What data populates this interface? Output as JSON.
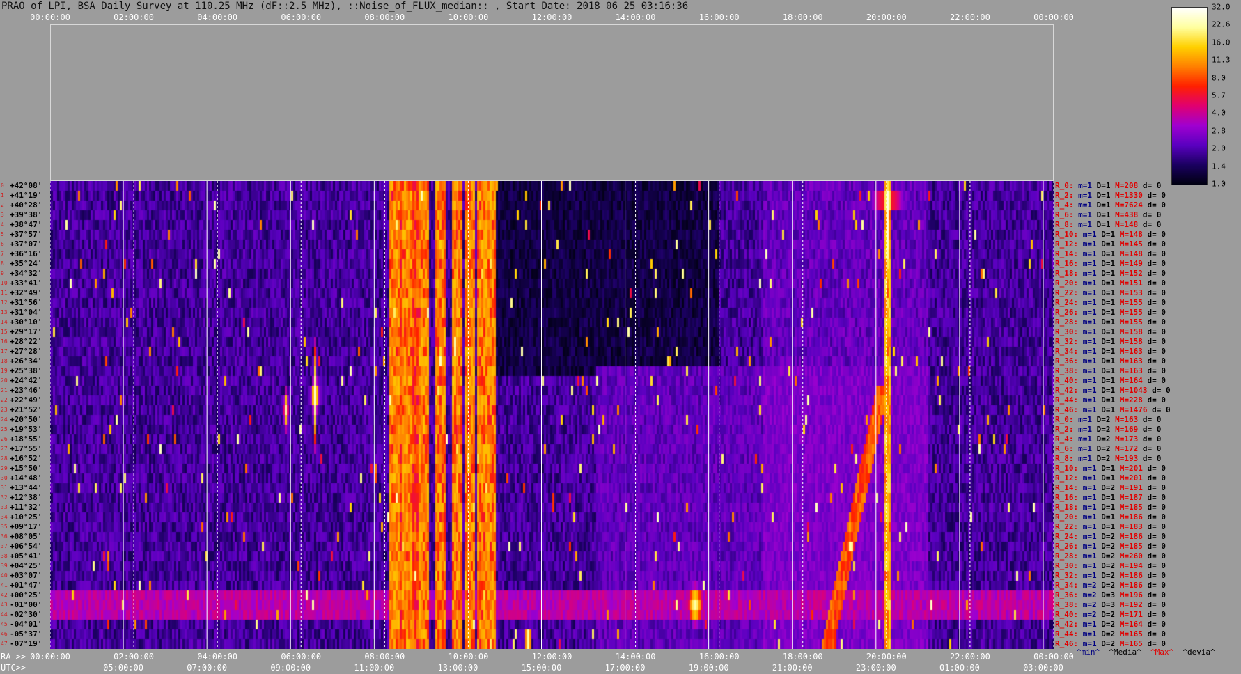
{
  "title": "PRAO of LPI, BSA Daily Survey at 110.25 MHz (dF::2.5 MHz), ::Noise_of_FLUX_median:: , Start Date: 2018 06 25 03:16:36",
  "top_axis_labels": [
    "00:00:00",
    "02:00:00",
    "04:00:00",
    "06:00:00",
    "08:00:00",
    "10:00:00",
    "12:00:00",
    "14:00:00",
    "16:00:00",
    "18:00:00",
    "20:00:00",
    "22:00:00",
    "00:00:00"
  ],
  "ra_prefix": "RA >>",
  "ra_labels": [
    "00:00:00",
    "02:00:00",
    "04:00:00",
    "06:00:00",
    "08:00:00",
    "10:00:00",
    "12:00:00",
    "14:00:00",
    "16:00:00",
    "18:00:00",
    "20:00:00",
    "22:00:00",
    "00:00:00"
  ],
  "utc_prefix": "UTC>>",
  "utc_labels": [
    "05:00:00",
    "07:00:00",
    "09:00:00",
    "11:00:00",
    "13:00:00",
    "15:00:00",
    "17:00:00",
    "19:00:00",
    "21:00:00",
    "23:00:00",
    "01:00:00",
    "03:00:00"
  ],
  "declinations": [
    "+42°08'",
    "+41°19'",
    "+40°28'",
    "+39°38'",
    "+38°47'",
    "+37°57'",
    "+37°07'",
    "+36°16'",
    "+35°24'",
    "+34°32'",
    "+33°41'",
    "+32°49'",
    "+31°56'",
    "+31°04'",
    "+30°10'",
    "+29°17'",
    "+28°22'",
    "+27°28'",
    "+26°34'",
    "+25°38'",
    "+24°42'",
    "+23°46'",
    "+22°49'",
    "+21°52'",
    "+20°50'",
    "+19°53'",
    "+18°55'",
    "+17°55'",
    "+16°52'",
    "+15°50'",
    "+14°48'",
    "+13°44'",
    "+12°38'",
    "+11°32'",
    "+10°25'",
    "+09°17'",
    "+08°05'",
    "+06°54'",
    "+05°41'",
    "+04°25'",
    "+03°07'",
    "+01°47'",
    "+00°25'",
    "-01°00'",
    "-02°30'",
    "-04°01'",
    "-05°37'",
    "-07°19'"
  ],
  "row_numbers": [
    "0",
    "1",
    "2",
    "3",
    "4",
    "5",
    "6",
    "7",
    "8",
    "9",
    "10",
    "11",
    "12",
    "13",
    "14",
    "15",
    "16",
    "17",
    "18",
    "19",
    "20",
    "21",
    "22",
    "23",
    "24",
    "25",
    "26",
    "27",
    "28",
    "29",
    "30",
    "31",
    "32",
    "33",
    "34",
    "35",
    "36",
    "37",
    "38",
    "39",
    "40",
    "41",
    "42",
    "43",
    "44",
    "45",
    "46",
    "47"
  ],
  "right_labels": [
    {
      "r": "R_0:",
      "m": "m=1",
      "D": "D=1",
      "M": "M=208",
      "d": "d= 0"
    },
    {
      "r": "R_2:",
      "m": "m=1",
      "D": "D=1",
      "M": "M=1330",
      "d": "d= 0"
    },
    {
      "r": "R_4:",
      "m": "m=1",
      "D": "D=1",
      "M": "M=7624",
      "d": "d= 0"
    },
    {
      "r": "R_6:",
      "m": "m=1",
      "D": "D=1",
      "M": "M=438",
      "d": "d= 0"
    },
    {
      "r": "R_8:",
      "m": "m=1",
      "D": "D=1",
      "M": "M=148",
      "d": "d= 0"
    },
    {
      "r": "R_10:",
      "m": "m=1",
      "D": "D=1",
      "M": "M=148",
      "d": "d= 0"
    },
    {
      "r": "R_12:",
      "m": "m=1",
      "D": "D=1",
      "M": "M=145",
      "d": "d= 0"
    },
    {
      "r": "R_14:",
      "m": "m=1",
      "D": "D=1",
      "M": "M=148",
      "d": "d= 0"
    },
    {
      "r": "R_16:",
      "m": "m=1",
      "D": "D=1",
      "M": "M=149",
      "d": "d= 0"
    },
    {
      "r": "R_18:",
      "m": "m=1",
      "D": "D=1",
      "M": "M=152",
      "d": "d= 0"
    },
    {
      "r": "R_20:",
      "m": "m=1",
      "D": "D=1",
      "M": "M=151",
      "d": "d= 0"
    },
    {
      "r": "R_22:",
      "m": "m=1",
      "D": "D=1",
      "M": "M=153",
      "d": "d= 0"
    },
    {
      "r": "R_24:",
      "m": "m=1",
      "D": "D=1",
      "M": "M=155",
      "d": "d= 0"
    },
    {
      "r": "R_26:",
      "m": "m=1",
      "D": "D=1",
      "M": "M=155",
      "d": "d= 0"
    },
    {
      "r": "R_28:",
      "m": "m=1",
      "D": "D=1",
      "M": "M=155",
      "d": "d= 0"
    },
    {
      "r": "R_30:",
      "m": "m=1",
      "D": "D=1",
      "M": "M=158",
      "d": "d= 0"
    },
    {
      "r": "R_32:",
      "m": "m=1",
      "D": "D=1",
      "M": "M=158",
      "d": "d= 0"
    },
    {
      "r": "R_34:",
      "m": "m=1",
      "D": "D=1",
      "M": "M=163",
      "d": "d= 0"
    },
    {
      "r": "R_36:",
      "m": "m=1",
      "D": "D=1",
      "M": "M=163",
      "d": "d= 0"
    },
    {
      "r": "R_38:",
      "m": "m=1",
      "D": "D=1",
      "M": "M=163",
      "d": "d= 0"
    },
    {
      "r": "R_40:",
      "m": "m=1",
      "D": "D=1",
      "M": "M=164",
      "d": "d= 0"
    },
    {
      "r": "R_42:",
      "m": "m=1",
      "D": "D=1",
      "M": "M=1043",
      "d": "d= 0"
    },
    {
      "r": "R_44:",
      "m": "m=1",
      "D": "D=1",
      "M": "M=228",
      "d": "d= 0"
    },
    {
      "r": "R_46:",
      "m": "m=1",
      "D": "D=1",
      "M": "M=1476",
      "d": "d= 0"
    },
    {
      "r": "R_0:",
      "m": "m=1",
      "D": "D=2",
      "M": "M=163",
      "d": "d= 0"
    },
    {
      "r": "R_2:",
      "m": "m=1",
      "D": "D=2",
      "M": "M=169",
      "d": "d= 0"
    },
    {
      "r": "R_4:",
      "m": "m=1",
      "D": "D=2",
      "M": "M=173",
      "d": "d= 0"
    },
    {
      "r": "R_6:",
      "m": "m=1",
      "D": "D=2",
      "M": "M=172",
      "d": "d= 0"
    },
    {
      "r": "R_8:",
      "m": "m=1",
      "D": "D=2",
      "M": "M=193",
      "d": "d= 0"
    },
    {
      "r": "R_10:",
      "m": "m=1",
      "D": "D=1",
      "M": "M=201",
      "d": "d= 0"
    },
    {
      "r": "R_12:",
      "m": "m=1",
      "D": "D=1",
      "M": "M=201",
      "d": "d= 0"
    },
    {
      "r": "R_14:",
      "m": "m=1",
      "D": "D=2",
      "M": "M=191",
      "d": "d= 0"
    },
    {
      "r": "R_16:",
      "m": "m=1",
      "D": "D=1",
      "M": "M=187",
      "d": "d= 0"
    },
    {
      "r": "R_18:",
      "m": "m=1",
      "D": "D=1",
      "M": "M=185",
      "d": "d= 0"
    },
    {
      "r": "R_20:",
      "m": "m=1",
      "D": "D=1",
      "M": "M=186",
      "d": "d= 0"
    },
    {
      "r": "R_22:",
      "m": "m=1",
      "D": "D=1",
      "M": "M=183",
      "d": "d= 0"
    },
    {
      "r": "R_24:",
      "m": "m=1",
      "D": "D=2",
      "M": "M=186",
      "d": "d= 0"
    },
    {
      "r": "R_26:",
      "m": "m=1",
      "D": "D=2",
      "M": "M=185",
      "d": "d= 0"
    },
    {
      "r": "R_28:",
      "m": "m=1",
      "D": "D=2",
      "M": "M=260",
      "d": "d= 0"
    },
    {
      "r": "R_30:",
      "m": "m=1",
      "D": "D=2",
      "M": "M=194",
      "d": "d= 0"
    },
    {
      "r": "R_32:",
      "m": "m=1",
      "D": "D=2",
      "M": "M=186",
      "d": "d= 0"
    },
    {
      "r": "R_34:",
      "m": "m=2",
      "D": "D=2",
      "M": "M=186",
      "d": "d= 0"
    },
    {
      "r": "R_36:",
      "m": "m=2",
      "D": "D=3",
      "M": "M=196",
      "d": "d= 0"
    },
    {
      "r": "R_38:",
      "m": "m=2",
      "D": "D=3",
      "M": "M=192",
      "d": "d= 0"
    },
    {
      "r": "R_40:",
      "m": "m=2",
      "D": "D=2",
      "M": "M=171",
      "d": "d= 0"
    },
    {
      "r": "R_42:",
      "m": "m=1",
      "D": "D=2",
      "M": "M=164",
      "d": "d= 0"
    },
    {
      "r": "R_44:",
      "m": "m=1",
      "D": "D=2",
      "M": "M=165",
      "d": "d= 0"
    },
    {
      "r": "R_46:",
      "m": "m=1",
      "D": "D=2",
      "M": "M=165",
      "d": "d= 0"
    }
  ],
  "stat_legend": {
    "min": "^min^",
    "median": "^Media^",
    "max": "^Max^",
    "devia": "^devia^"
  },
  "colorbar_ticks": [
    "32.0",
    "22.6",
    "16.0",
    "11.3",
    "8.0",
    "5.7",
    "4.0",
    "2.8",
    "2.0",
    "1.4",
    "1.0"
  ],
  "colors": {
    "background": "#9c9c9c",
    "label_red": "#e00000",
    "label_navy": "#000080",
    "colormap": [
      "#000010",
      "#1a0060",
      "#5a00c0",
      "#a000d0",
      "#e00070",
      "#ff2000",
      "#ff8000",
      "#ffd000",
      "#ffffa0",
      "#ffffff"
    ]
  },
  "chart_data": {
    "type": "heatmap",
    "title": "PRAO of LPI, BSA Daily Survey at 110.25 MHz (dF::2.5 MHz), ::Noise_of_FLUX_median:: , Start Date: 2018 06 25 03:16:36",
    "x_axis": "RA / UTC, 00:00:00 to 24:00:00 (RA), 05:00:00 to 03:00:00 (UTC)",
    "y_axis": "Declination rows 0-47, +42°08' to -07°19'",
    "colorbar": {
      "min": 1.0,
      "max": 32.0,
      "scale": "log2",
      "ticks": [
        32.0,
        22.6,
        16.0,
        11.3,
        8.0,
        5.7,
        4.0,
        2.8,
        2.0,
        1.4,
        1.0
      ]
    },
    "rows": 48,
    "x_hours": [
      0,
      24
    ],
    "features": [
      {
        "name": "vertical interference bands",
        "ra_hours": [
          8.2,
          8.5,
          8.9,
          9.3,
          9.7,
          10.0,
          10.3,
          10.5
        ],
        "level": 11.3
      },
      {
        "name": "bright point source",
        "ra_hours": 20.0,
        "dec_rows": [
          0,
          7
        ],
        "level": 32.0
      },
      {
        "name": "bright point source",
        "ra_hours": 6.3,
        "dec_rows": [
          20,
          23
        ],
        "level": 32.0
      },
      {
        "name": "bright point source",
        "ra_hours": 5.6,
        "dec_rows": [
          22,
          24
        ],
        "level": 22.6
      },
      {
        "name": "bright spot",
        "ra_hours": 15.4,
        "dec_rows": [
          42,
          45
        ],
        "level": 22.6
      },
      {
        "name": "bright spot",
        "ra_hours": 11.4,
        "dec_rows": [
          46,
          47
        ],
        "level": 32.0
      },
      {
        "name": "galactic plane arm",
        "ra_hours": [
          18.5,
          20.0
        ],
        "dec_rows": [
          20,
          47
        ],
        "level": 8.0
      },
      {
        "name": "horizontal bright band",
        "dec_rows": [
          42,
          44
        ],
        "level": 5.7
      }
    ]
  }
}
